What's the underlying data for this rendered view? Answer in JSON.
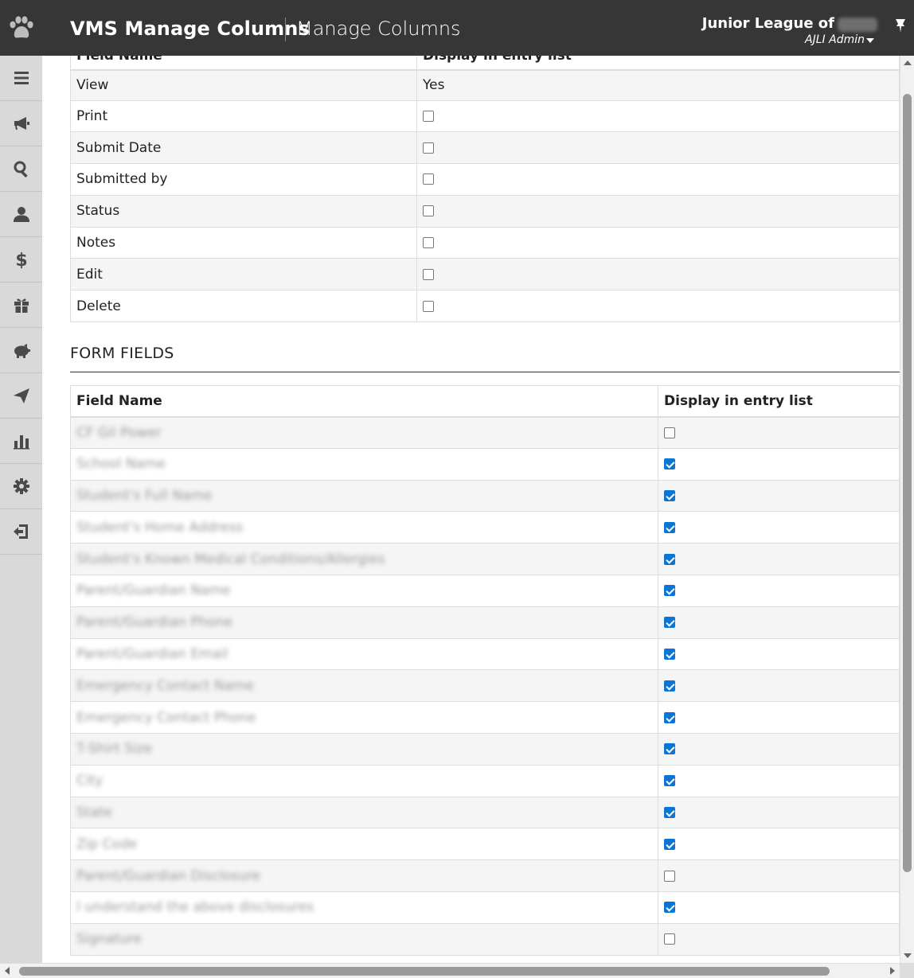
{
  "header": {
    "app_title": "VMS Manage Columns",
    "page_title": "Manage Columns",
    "org_name": "Junior League of",
    "user_role": "AJLI Admin"
  },
  "sidebar": {
    "items": [
      {
        "icon": "menu-icon"
      },
      {
        "icon": "megaphone-icon"
      },
      {
        "icon": "search-icon"
      },
      {
        "icon": "user-icon"
      },
      {
        "icon": "dollar-icon"
      },
      {
        "icon": "gift-icon"
      },
      {
        "icon": "piggy-bank-icon"
      },
      {
        "icon": "send-icon"
      },
      {
        "icon": "bar-chart-icon"
      },
      {
        "icon": "gear-icon"
      },
      {
        "icon": "sign-out-icon"
      }
    ]
  },
  "standard_table": {
    "col_field": "Field Name",
    "col_display": "Display in entry list",
    "rows": [
      {
        "name": "View",
        "value": "Yes"
      },
      {
        "name": "Print",
        "checked": false
      },
      {
        "name": "Submit Date",
        "checked": false
      },
      {
        "name": "Submitted by",
        "checked": false
      },
      {
        "name": "Status",
        "checked": false
      },
      {
        "name": "Notes",
        "checked": false
      },
      {
        "name": "Edit",
        "checked": false
      },
      {
        "name": "Delete",
        "checked": false
      }
    ]
  },
  "form_fields": {
    "section_title": "FORM FIELDS",
    "col_field": "Field Name",
    "col_display": "Display in entry list",
    "rows": [
      {
        "name": "CF Gil Power",
        "checked": false
      },
      {
        "name": "School Name",
        "checked": true
      },
      {
        "name": "Student's Full Name",
        "checked": true
      },
      {
        "name": "Student's Home Address",
        "checked": true
      },
      {
        "name": "Student's Known Medical Conditions/Allergies",
        "checked": true
      },
      {
        "name": "Parent/Guardian Name",
        "checked": true
      },
      {
        "name": "Parent/Guardian Phone",
        "checked": true
      },
      {
        "name": "Parent/Guardian Email",
        "checked": true
      },
      {
        "name": "Emergency Contact Name",
        "checked": true
      },
      {
        "name": "Emergency Contact Phone",
        "checked": true
      },
      {
        "name": "T-Shirt Size",
        "checked": true
      },
      {
        "name": "City",
        "checked": true
      },
      {
        "name": "State",
        "checked": true
      },
      {
        "name": "Zip Code",
        "checked": true
      },
      {
        "name": "Parent/Guardian Disclosure",
        "checked": false
      },
      {
        "name": "I understand the above disclosures",
        "checked": true
      },
      {
        "name": "Signature",
        "checked": false
      }
    ]
  },
  "colors": {
    "header_bg": "#363636",
    "sidebar_bg": "#d9d9d9",
    "checkbox_checked": "#0b75d6"
  }
}
